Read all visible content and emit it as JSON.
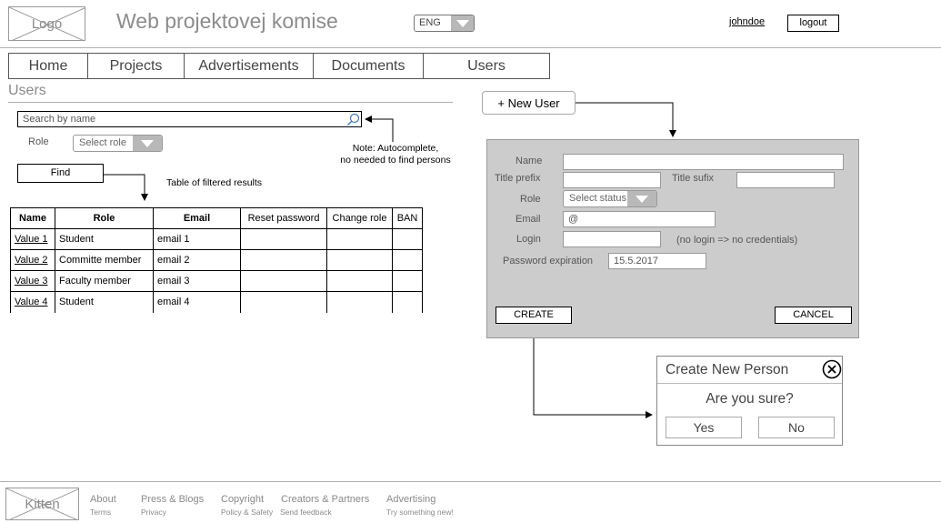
{
  "header": {
    "logo": "Logo",
    "title": "Web projektovej komise",
    "lang": "ENG",
    "username": "johndoe",
    "logout": "logout"
  },
  "nav": [
    "Home",
    "Projects",
    "Advertisements",
    "Documents",
    "Users"
  ],
  "users": {
    "section_title": "Users",
    "search_placeholder": "Search by name",
    "role_label": "Role",
    "role_select": "Select role",
    "find_button": "Find",
    "note": [
      "Note: Autocomplete,",
      "no needed to find persons"
    ],
    "table_caption": "Table of filtered results",
    "columns": [
      "Name",
      "Role",
      "Email",
      "Reset password",
      "Change role",
      "BAN"
    ],
    "rows": [
      {
        "name": "Value 1",
        "role": "Student",
        "email": "email 1"
      },
      {
        "name": "Value 2",
        "role": "Committe member",
        "email": "email 2"
      },
      {
        "name": "Value 3",
        "role": "Faculty member",
        "email": "email 3"
      },
      {
        "name": "Value 4",
        "role": "Student",
        "email": "email 4"
      }
    ]
  },
  "new_user": {
    "button": "+ New User",
    "name_label": "Name",
    "title_prefix_label": "Title prefix",
    "title_sufix_label": "Title sufix",
    "role_label": "Role",
    "role_select": "Select status",
    "email_label": "Email",
    "email_placeholder": "@",
    "login_label": "Login",
    "login_hint": "(no login => no credentials)",
    "password_expiration_label": "Password expiration",
    "password_expiration_value": "15.5.2017",
    "create_button": "CREATE",
    "cancel_button": "CANCEL"
  },
  "dialog": {
    "title": "Create New Person",
    "question": "Are you sure?",
    "yes": "Yes",
    "no": "No"
  },
  "footer": {
    "logo": "Kitten",
    "col1": {
      "main": "About",
      "sub": "Terms"
    },
    "col2": {
      "main": "Press & Blogs",
      "sub": "Privacy"
    },
    "col3": {
      "main": "Copyright",
      "sub": "Policy & Safety"
    },
    "col4": {
      "main": "Creators & Partners",
      "sub": "Send feedback"
    },
    "col5": {
      "main": "Advertising",
      "sub": "Try something new!"
    }
  }
}
